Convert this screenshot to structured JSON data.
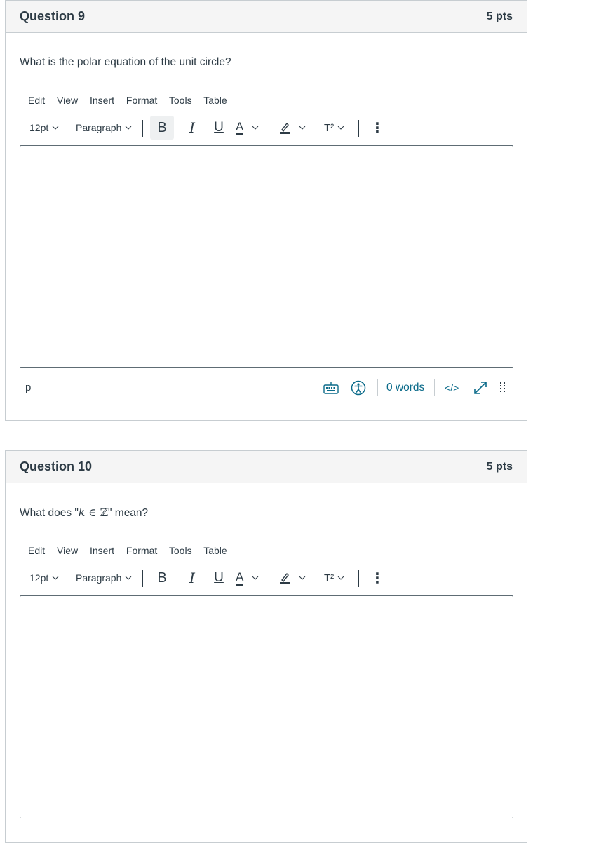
{
  "questions": [
    {
      "title": "Question 9",
      "points": "5 pts",
      "text_before": "What is the polar equation of the unit circle?",
      "math": "",
      "text_after": "",
      "menu": [
        "Edit",
        "View",
        "Insert",
        "Format",
        "Tools",
        "Table"
      ],
      "font_size": "12pt",
      "block_format": "Paragraph",
      "path": "p",
      "word_count": "0 words",
      "html_toggle": "</>"
    },
    {
      "title": "Question 10",
      "points": "5 pts",
      "text_before": "What does \"",
      "math_var": "k",
      "math_in": " ∈ ",
      "math_set": "ℤ",
      "text_after": "\" mean?",
      "menu": [
        "Edit",
        "View",
        "Insert",
        "Format",
        "Tools",
        "Table"
      ],
      "font_size": "12pt",
      "block_format": "Paragraph"
    }
  ],
  "toolbar_glyphs": {
    "bold": "B",
    "italic": "I",
    "underline": "U",
    "text_color": "A",
    "superscript": "T²",
    "more": "⋮"
  },
  "colors": {
    "header_bg": "#f5f5f5",
    "border": "#c7cdd1",
    "text": "#2d3b45",
    "link": "#0b6b8a"
  }
}
